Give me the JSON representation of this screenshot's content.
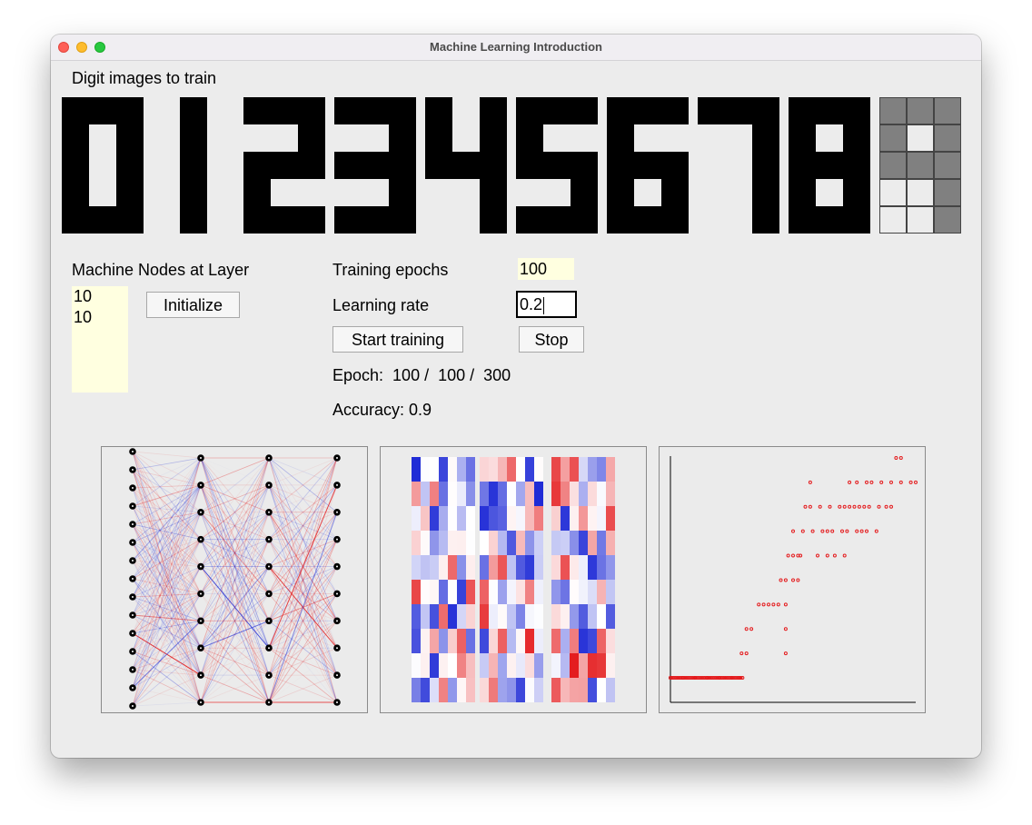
{
  "window": {
    "title": "Machine Learning Introduction"
  },
  "digits": {
    "label": "Digit images to train",
    "selected_index": 9,
    "patterns": [
      "111101101101111",
      "010010010010010",
      "111001111100111",
      "111001111001111",
      "101101111001001",
      "111100111001111",
      "111100111101111",
      "111001001001001",
      "111101111101111",
      "111101111001001"
    ]
  },
  "layers": {
    "label": "Machine Nodes at Layer",
    "values": [
      "10",
      "10"
    ],
    "initialize_label": "Initialize"
  },
  "training": {
    "epochs_label": "Training epochs",
    "epochs_value": "100",
    "rate_label": "Learning rate",
    "rate_value": "0.2",
    "start_label": "Start training",
    "stop_label": "Stop",
    "epoch_text": "Epoch:  100 /  100 /  300",
    "accuracy_text": "Accuracy: 0.9"
  },
  "colors": {
    "positive": "#e41a1c",
    "negative": "#1f2bd6",
    "node": "#000000",
    "digit_on": "#000000",
    "digit_selected_on": "#808080"
  },
  "network": {
    "layer_sizes": [
      15,
      10,
      10,
      10
    ]
  },
  "chart_data": {
    "type": "scatter",
    "description_series": "accuracy per sample across epochs",
    "points": [
      [
        0,
        0.0
      ],
      [
        5,
        0.0
      ],
      [
        10,
        0.0
      ],
      [
        15,
        0.0
      ],
      [
        20,
        0.0
      ],
      [
        25,
        0.0
      ],
      [
        28,
        0.0
      ],
      [
        29,
        0.1
      ],
      [
        31,
        0.1
      ],
      [
        47,
        0.1
      ],
      [
        31,
        0.2
      ],
      [
        33,
        0.2
      ],
      [
        47,
        0.2
      ],
      [
        36,
        0.3
      ],
      [
        38,
        0.3
      ],
      [
        40,
        0.3
      ],
      [
        42,
        0.3
      ],
      [
        44,
        0.3
      ],
      [
        47,
        0.3
      ],
      [
        45,
        0.4
      ],
      [
        47,
        0.4
      ],
      [
        50,
        0.4
      ],
      [
        52,
        0.4
      ],
      [
        48,
        0.5
      ],
      [
        50,
        0.5
      ],
      [
        52,
        0.5
      ],
      [
        53,
        0.5
      ],
      [
        60,
        0.5
      ],
      [
        64,
        0.5
      ],
      [
        67,
        0.5
      ],
      [
        71,
        0.5
      ],
      [
        50,
        0.6
      ],
      [
        54,
        0.6
      ],
      [
        58,
        0.6
      ],
      [
        62,
        0.6
      ],
      [
        64,
        0.6
      ],
      [
        66,
        0.6
      ],
      [
        70,
        0.6
      ],
      [
        72,
        0.6
      ],
      [
        76,
        0.6
      ],
      [
        78,
        0.6
      ],
      [
        80,
        0.6
      ],
      [
        84,
        0.6
      ],
      [
        55,
        0.7
      ],
      [
        57,
        0.7
      ],
      [
        61,
        0.7
      ],
      [
        65,
        0.7
      ],
      [
        69,
        0.7
      ],
      [
        71,
        0.7
      ],
      [
        73,
        0.7
      ],
      [
        75,
        0.7
      ],
      [
        77,
        0.7
      ],
      [
        79,
        0.7
      ],
      [
        81,
        0.7
      ],
      [
        85,
        0.7
      ],
      [
        88,
        0.7
      ],
      [
        90,
        0.7
      ],
      [
        57,
        0.8
      ],
      [
        73,
        0.8
      ],
      [
        76,
        0.8
      ],
      [
        80,
        0.8
      ],
      [
        82,
        0.8
      ],
      [
        86,
        0.8
      ],
      [
        90,
        0.8
      ],
      [
        94,
        0.8
      ],
      [
        98,
        0.8
      ],
      [
        100,
        0.8
      ],
      [
        92,
        0.9
      ],
      [
        94,
        0.9
      ]
    ],
    "xlim": [
      0,
      100
    ],
    "ylim": [
      0,
      0.9
    ]
  }
}
